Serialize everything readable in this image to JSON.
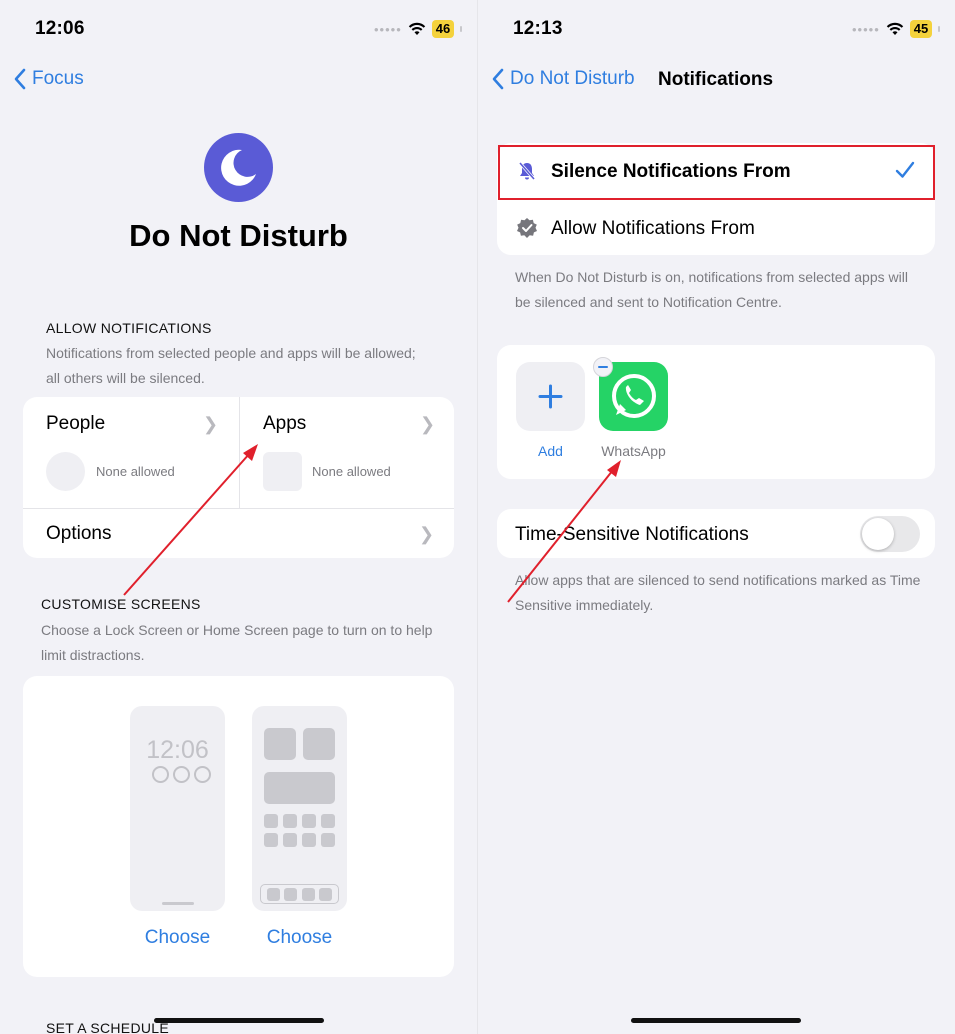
{
  "left": {
    "status": {
      "time": "12:06",
      "battery": "46"
    },
    "nav": {
      "back_label": "Focus"
    },
    "focus_title": "Do Not Disturb",
    "allow_section": {
      "header": "ALLOW NOTIFICATIONS",
      "description": "Notifications from selected people and apps will be allowed; all others will be silenced.",
      "people": {
        "label": "People",
        "status": "None allowed"
      },
      "apps": {
        "label": "Apps",
        "status": "None allowed"
      },
      "options": {
        "label": "Options"
      }
    },
    "customise_section": {
      "header": "CUSTOMISE SCREENS",
      "description": "Choose a Lock Screen or Home Screen page to turn on to help limit distractions.",
      "lock_preview_time": "12:06",
      "choose_lock_label": "Choose",
      "choose_home_label": "Choose"
    },
    "schedule_header": "SET A SCHEDULE"
  },
  "right": {
    "status": {
      "time": "12:13",
      "battery": "45"
    },
    "nav": {
      "back_label": "Do Not Disturb",
      "title": "Notifications"
    },
    "mode_options": [
      {
        "label": "Silence Notifications From",
        "selected": true
      },
      {
        "label": "Allow Notifications From",
        "selected": false
      }
    ],
    "mode_description": "When Do Not Disturb is on, notifications from selected apps will be silenced and sent to Notification Centre.",
    "apps": {
      "add_label": "Add",
      "items": [
        {
          "name": "WhatsApp"
        }
      ]
    },
    "time_sensitive": {
      "label": "Time-Sensitive Notifications",
      "enabled": false,
      "description": "Allow apps that are silenced to send notifications marked as Time Sensitive immediately."
    }
  },
  "colors": {
    "accent": "#2f7ee0",
    "focus_icon": "#5a5bd6",
    "whatsapp": "#25d366",
    "highlight_box": "#e0202c",
    "annotation_arrow": "#e0202c",
    "battery": "#f4d23c"
  }
}
